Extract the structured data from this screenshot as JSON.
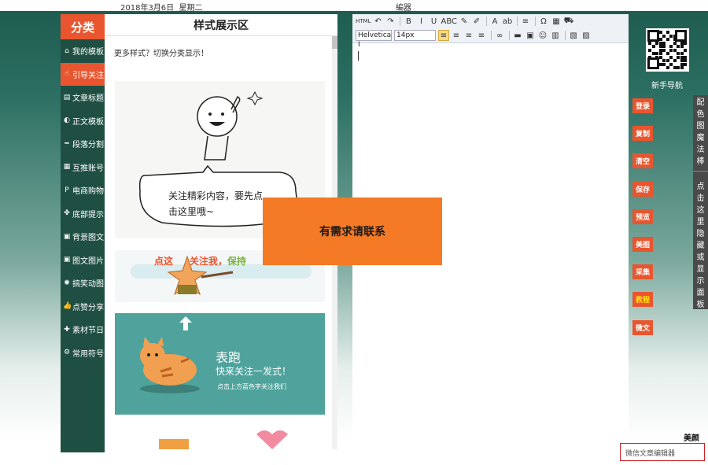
{
  "topbar": {
    "date": "2018年3月6日",
    "weekday": "星期二",
    "title": "編器"
  },
  "categories": {
    "title": "分类",
    "items": [
      {
        "icon": "home-icon",
        "glyph": "⌂",
        "label": "我的模板"
      },
      {
        "icon": "hand-pointer-icon",
        "glyph": "☝",
        "label": "引导关注"
      },
      {
        "icon": "file-icon",
        "glyph": "▤",
        "label": "文章标题"
      },
      {
        "icon": "contrast-icon",
        "glyph": "◐",
        "label": "正文模板"
      },
      {
        "icon": "minus-icon",
        "glyph": "━",
        "label": "段落分割"
      },
      {
        "icon": "grid-icon",
        "glyph": "▦",
        "label": "互推账号"
      },
      {
        "icon": "paypal-icon",
        "glyph": "P",
        "label": "电商购物"
      },
      {
        "icon": "puzzle-icon",
        "glyph": "✤",
        "label": "底部提示"
      },
      {
        "icon": "image-icon",
        "glyph": "▣",
        "label": "背景图文"
      },
      {
        "icon": "picture-icon",
        "glyph": "▣",
        "label": "图文图片"
      },
      {
        "icon": "spinner-icon",
        "glyph": "✺",
        "label": "搞笑动图"
      },
      {
        "icon": "thumbs-up-icon",
        "glyph": "👍",
        "label": "点赞分享"
      },
      {
        "icon": "gift-icon",
        "glyph": "✚",
        "label": "素材节日"
      },
      {
        "icon": "cogs-icon",
        "glyph": "⚙",
        "label": "常用符号"
      }
    ],
    "active_index": 1
  },
  "showcase": {
    "title": "样式展示区",
    "hint": "更多样式？切换分类显示！",
    "card1_line1": "关注精彩内容，要先点",
    "card1_line2": "击这里哦~",
    "card2_a": "点这",
    "card2_b": "关注我，",
    "card2_c": "保持",
    "card3_title": "表跑",
    "card3_sub": "快来关注一发式！",
    "card3_small": "点击上方蓝色字关注我们"
  },
  "notice": "有需求请联系",
  "editor": {
    "font_family": "Helvetica I",
    "font_size": "14px",
    "toolbar_row1": [
      "HTML",
      "↶",
      "↷",
      "B",
      "I",
      "U",
      "ABC",
      "✎",
      "✐",
      "A",
      "ab",
      "≡",
      "Ω",
      "▦",
      "⛟"
    ],
    "toolbar_row2_align": [
      "≡",
      "≡",
      "≡",
      "≡"
    ]
  },
  "right_panel": {
    "guide": "新手导航",
    "buttons": [
      {
        "label": "登录",
        "highlight": false
      },
      {
        "label": "复制",
        "highlight": false
      },
      {
        "label": "清空",
        "highlight": false
      },
      {
        "label": "保存",
        "highlight": false
      },
      {
        "label": "预览",
        "highlight": false
      },
      {
        "label": "美图",
        "highlight": false
      },
      {
        "label": "采集",
        "highlight": false
      },
      {
        "label": "教程",
        "highlight": true
      },
      {
        "label": "微文",
        "highlight": false
      }
    ],
    "side_tab_1": "配色图魔法棒",
    "side_tab_2": "点击这里隐藏或显示面板",
    "beauty_label": "美颜",
    "wechat_input": "微信文章编辑器"
  },
  "colors": {
    "accent": "#e8552e",
    "sidebar": "#1f4f43",
    "notice": "#f47a25",
    "highlight_text": "#ffe600"
  }
}
